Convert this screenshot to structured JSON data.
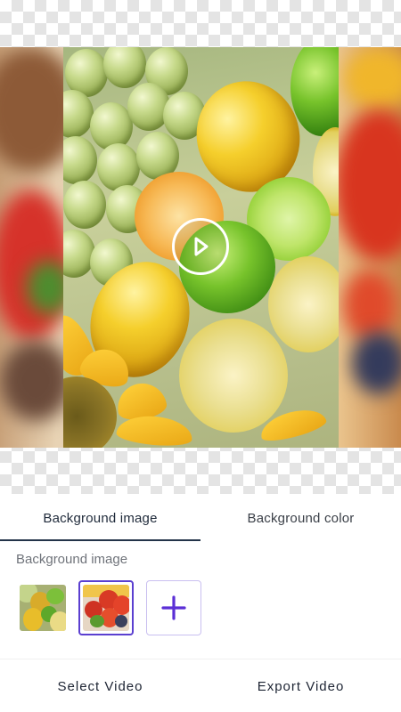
{
  "preview": {
    "play_icon": "play-icon"
  },
  "tabs": [
    {
      "label": "Background image",
      "active": true
    },
    {
      "label": "Background color",
      "active": false
    }
  ],
  "section": {
    "label": "Background image"
  },
  "thumbnails": [
    {
      "name": "citrus-thumbnail",
      "selected": false
    },
    {
      "name": "tomatoes-thumbnail",
      "selected": true
    }
  ],
  "add_button": {
    "icon": "plus-icon"
  },
  "bottom": {
    "select_label": "Select Video",
    "export_label": "Export Video"
  },
  "colors": {
    "accent": "#5b3fd0",
    "tab_indicator": "#233349",
    "text_primary": "#1d2433",
    "text_secondary": "#6f737a"
  }
}
